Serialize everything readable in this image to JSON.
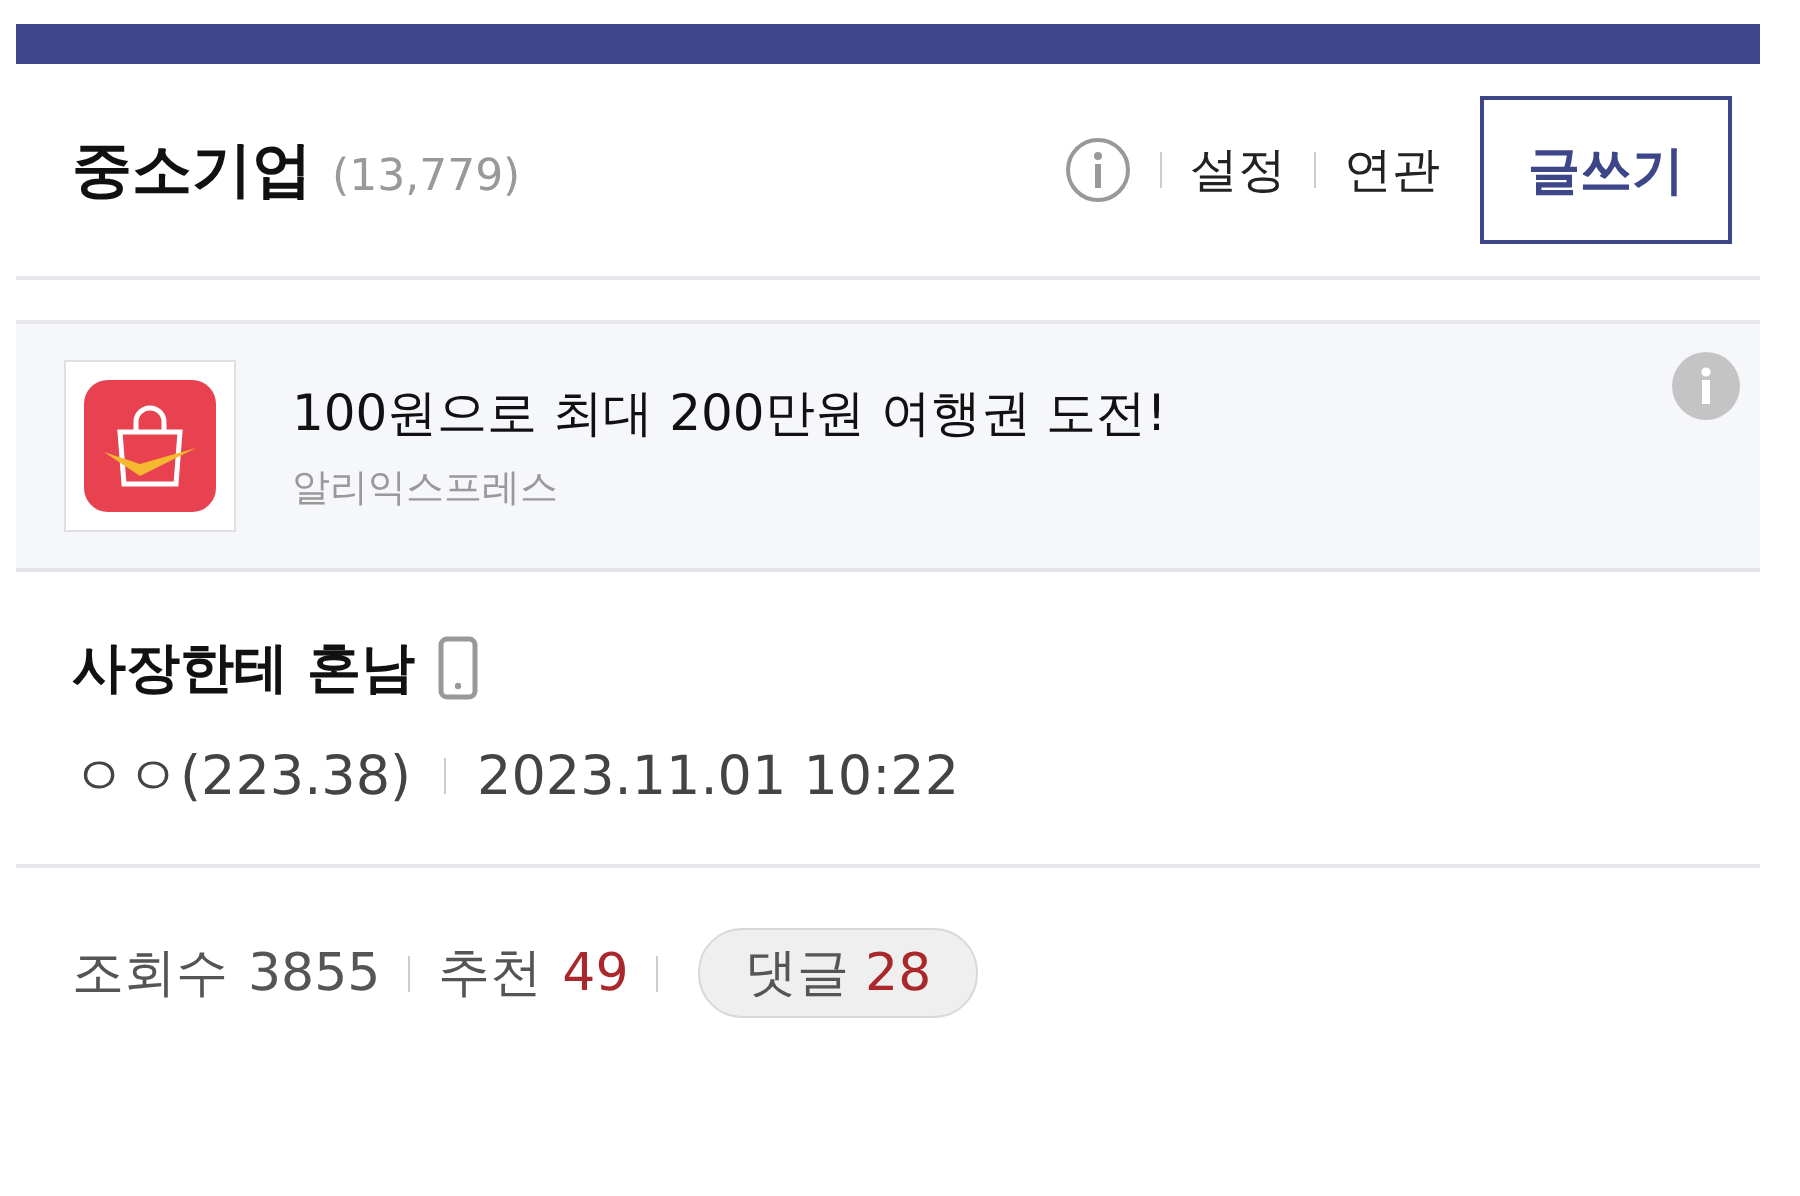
{
  "board": {
    "title": "중소기업",
    "count": "(13,779)",
    "links": [
      "설정",
      "연관"
    ],
    "write_button": "글쓰기"
  },
  "ad": {
    "headline": "100원으로 최대 200만원 여행권 도전!",
    "advertiser": "알리익스프레스"
  },
  "post": {
    "title": "사장한테 혼남",
    "author": "ㅇㅇ(223.38)",
    "date": "2023.11.01 10:22"
  },
  "stats": {
    "views_label": "조회수",
    "views": "3855",
    "recommend_label": "추천",
    "recommend": "49",
    "comments_label": "댓글",
    "comments": "28"
  }
}
